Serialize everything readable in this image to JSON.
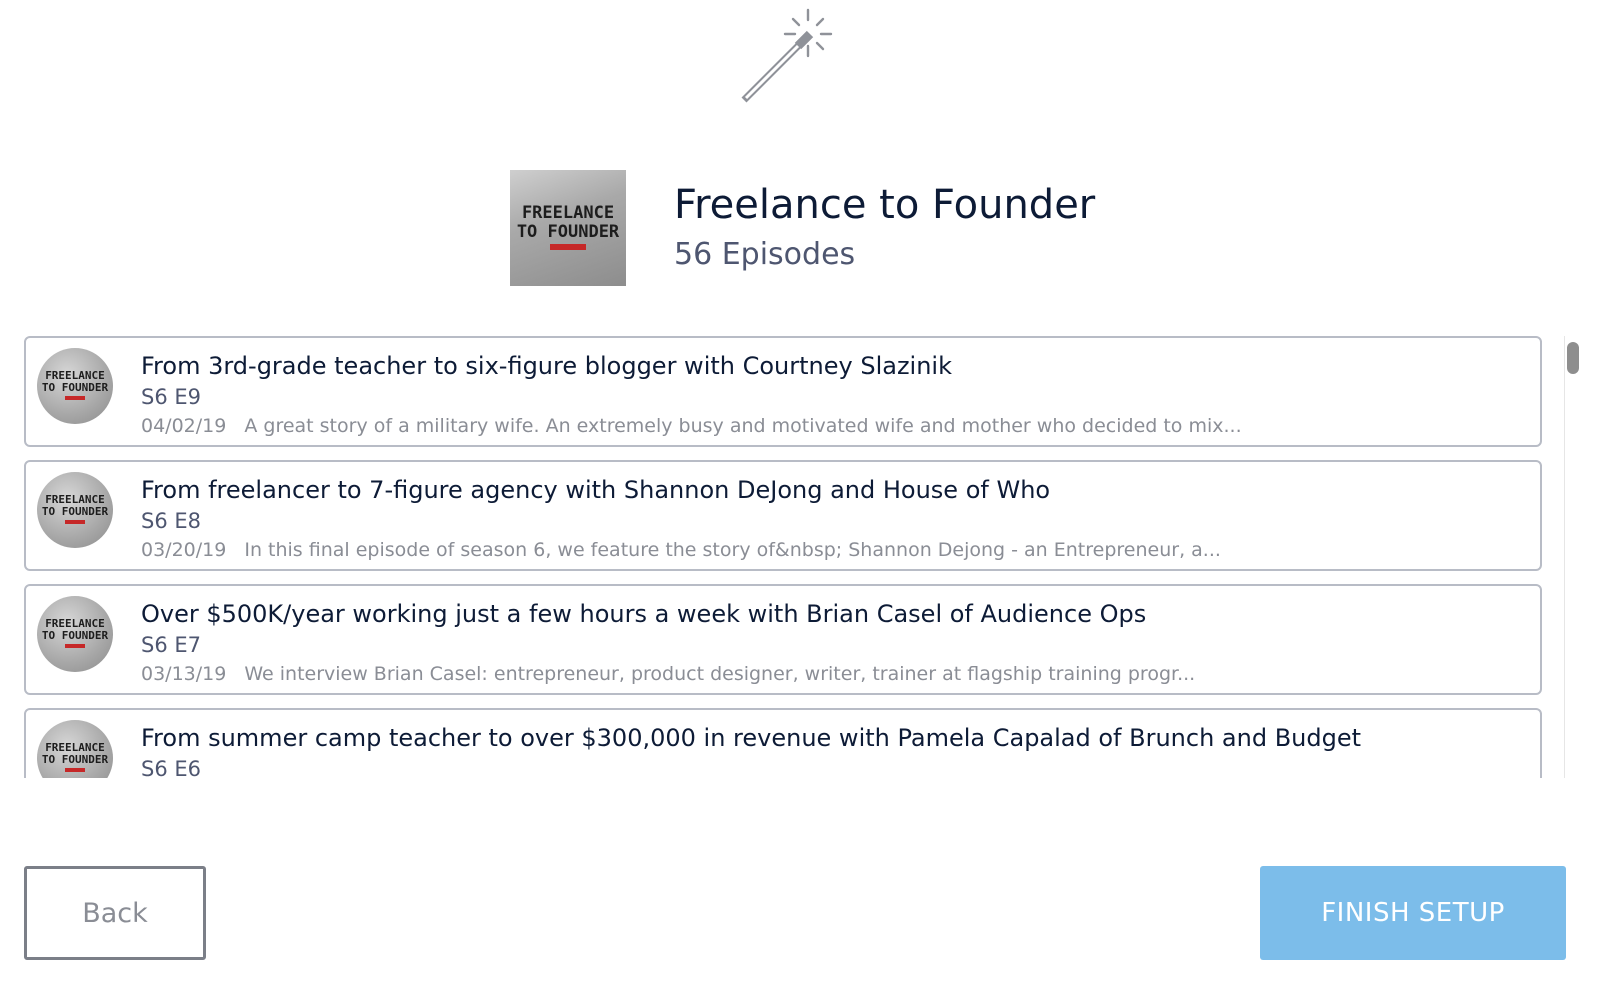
{
  "header": {
    "wand_icon": "magic-wand-icon"
  },
  "podcast": {
    "cover_title_line1": "FREELANCE",
    "cover_title_line2": "TO FOUNDER",
    "title": "Freelance to Founder",
    "episode_count": "56 Episodes"
  },
  "episodes": [
    {
      "title": "From 3rd-grade teacher to six-figure blogger with Courtney Slazinik",
      "number": "S6 E9",
      "date": "04/02/19",
      "description": "A great story of a military wife. An extremely busy and motivated wife and mother who decided to mix..."
    },
    {
      "title": "From freelancer to 7-figure agency with Shannon DeJong and House of Who",
      "number": "S6 E8",
      "date": "03/20/19",
      "description": "In this final episode of season 6, we feature the story of&nbsp; Shannon Dejong - an Entrepreneur, a..."
    },
    {
      "title": "Over $500K/year working just a few hours a week with Brian Casel of Audience Ops",
      "number": "S6 E7",
      "date": "03/13/19",
      "description": "We interview Brian Casel: entrepreneur, product designer, writer, trainer at flagship training progr..."
    },
    {
      "title": "From summer camp teacher to over $300,000 in revenue with Pamela Capalad of Brunch and Budget",
      "number": "S6 E6",
      "date": "",
      "description": ""
    }
  ],
  "thumb": {
    "line1": "FREELANCE",
    "line2": "TO FOUNDER"
  },
  "footer": {
    "back_label": "Back",
    "finish_label": "FINISH SETUP"
  },
  "colors": {
    "accent": "#7cbdea",
    "title": "#0d1b36",
    "muted": "#8a8d95"
  }
}
